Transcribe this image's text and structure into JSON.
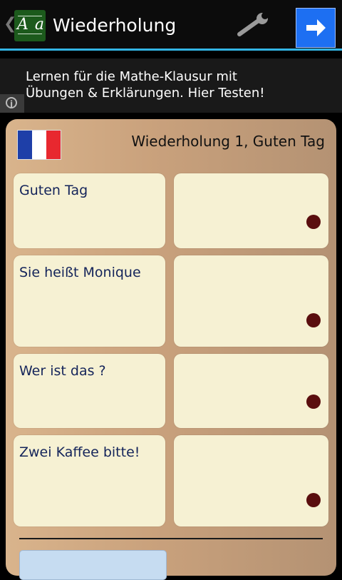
{
  "actionbar": {
    "back_glyph": "❮",
    "app_icon_text": "A a",
    "title": "Wiederholung",
    "settings_icon": "wrench-icon",
    "help_glyph": "?"
  },
  "ad": {
    "text": "Lernen für die Mathe-Klausur mit Übungen & Erklärungen. Hier Testen!",
    "button_icon": "arrow-right-icon",
    "info_glyph": "i"
  },
  "header": {
    "flag": "france-flag",
    "lesson_title": "Wiederholung 1, Guten Tag"
  },
  "cards": [
    {
      "question": "Guten Tag"
    },
    {
      "question": "Sie heißt Monique"
    },
    {
      "question": "Wer ist das ?"
    },
    {
      "question": "Zwei Kaffee bitte!"
    }
  ],
  "colors": {
    "accent_blue": "#33b5e5",
    "card_bg": "#f6f1d3",
    "dot": "#5a0e0e",
    "ad_button": "#1d6ff2"
  }
}
